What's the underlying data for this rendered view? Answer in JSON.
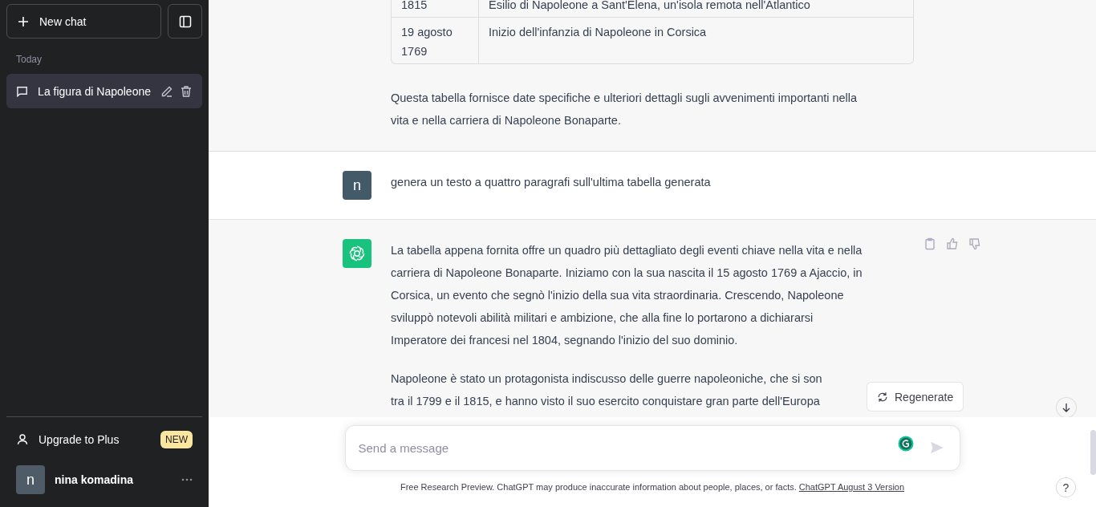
{
  "sidebar": {
    "new_chat": "New chat",
    "section": "Today",
    "chats": [
      {
        "title": "La figura di Napoleone",
        "selected": true
      }
    ],
    "upgrade": {
      "label": "Upgrade to Plus",
      "badge": "NEW"
    },
    "user": {
      "initial": "n",
      "name": "nina komadina"
    }
  },
  "conversation": [
    {
      "kind": "assistant",
      "table": {
        "rows": [
          [
            "1815",
            "Esilio di Napoleone a Sant'Elena, un'isola remota nell'Atlantico"
          ],
          [
            "19 agosto 1769",
            "Inizio dell'infanzia di Napoleone in Corsica"
          ]
        ]
      },
      "paragraphs": [
        [
          "Questa tabella fornisce date specifiche e ulteriori dettagli sugli avvenimenti importanti nella",
          "vita e nella carriera di Napoleone Bonaparte."
        ]
      ]
    },
    {
      "kind": "user",
      "avatar": "n",
      "paragraphs": [
        [
          "genera un testo a quattro paragrafi sull'ultima tabella generata"
        ]
      ]
    },
    {
      "kind": "assistant",
      "actions": true,
      "paragraphs": [
        [
          "La tabella appena fornita offre un quadro più dettagliato degli eventi chiave nella vita e nella",
          "carriera di Napoleone Bonaparte. Iniziamo con la sua nascita il 15 agosto 1769 a Ajaccio, in",
          "Corsica, un evento che segnò l'inizio della sua vita straordinaria. Crescendo, Napoleone",
          "sviluppò notevoli abilità militari e ambizione, che alla fine lo portarono a dichiararsi",
          "Imperatore dei francesi nel 1804, segnando l'inizio del suo dominio."
        ],
        [
          "Napoleone è stato un protagonista indiscusso delle guerre napoleoniche, che si son",
          "tra il 1799 e il 1815, e hanno visto il suo esercito conquistare gran parte dell'Europa"
        ]
      ]
    }
  ],
  "regenerate": "Regenerate",
  "composer": {
    "placeholder": "Send a message"
  },
  "footer": {
    "text": "Free Research Preview. ChatGPT may produce inaccurate information about people, places, or facts.",
    "link": "ChatGPT August 3 Version"
  },
  "help": "?"
}
